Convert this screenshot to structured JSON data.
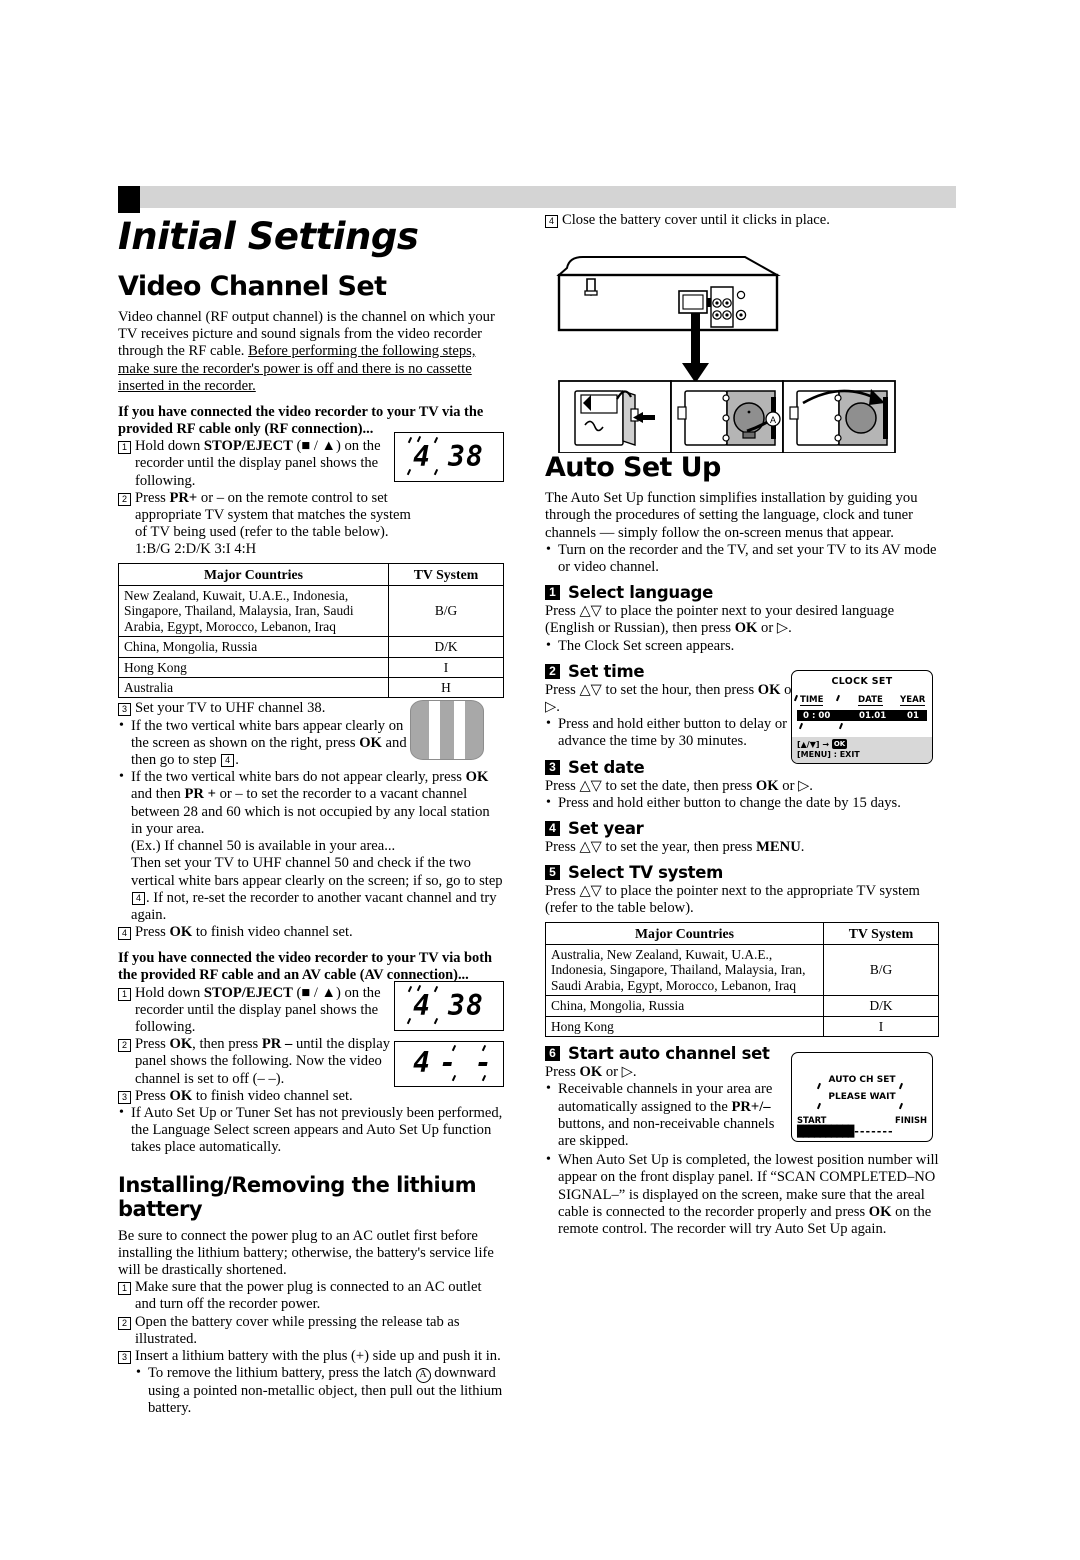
{
  "document": {
    "page_title": "Initial Settings"
  },
  "left_column": {
    "video_channel_set": {
      "heading": "Video Channel Set",
      "intro_plain": "Video channel (RF output channel) is the channel on which your TV receives picture and sound signals from the video recorder through the RF cable. ",
      "intro_underlined": "Before performing the following steps, make sure the recorder's power is off and there is no cassette inserted in the recorder.",
      "rf_section": {
        "lead": "If you have connected the video recorder to your TV via the provided RF cable only (RF connection)...",
        "step1_a": "Hold down ",
        "step1_b": "STOP/EJECT",
        "step1_c": " (■ / ▲) on the recorder until the display panel shows the following.",
        "step2_a": "Press ",
        "step2_b": "PR+",
        "step2_c": " or – on the remote control to set appropriate TV system that matches the system of TV being used (refer to the table below).",
        "systems_line": "1:B/G  2:D/K  3:I  4:H",
        "display_panel": {
          "channel_digit": "4",
          "channel_number": "38"
        },
        "step3": "Set your TV to UHF channel 38.",
        "bullet1_a": "If the two vertical white bars appear clearly on the screen as shown on the right, press ",
        "bullet1_b": "OK",
        "bullet1_c": " and then go to step ",
        "bullet1_step": "4",
        "bullet1_d": ".",
        "bullet2_a": "If the two vertical white bars do not appear clearly, press ",
        "bullet2_ok": "OK",
        "bullet2_b": " and then ",
        "bullet2_pr": "PR +",
        "bullet2_c": " or – to set the recorder to a vacant channel between 28 and 60 which is not occupied by any local station in your area.",
        "bullet2_ex": "(Ex.) If channel 50 is available in your area...",
        "bullet2_d": "Then set your TV to UHF channel 50 and check if the two vertical white bars appear clearly on the screen; if so, go to step ",
        "bullet2_step": "4",
        "bullet2_e": ". If not, re-set the recorder to another vacant channel and try again.",
        "step4_a": "Press ",
        "step4_b": "OK",
        "step4_c": " to finish video channel set."
      },
      "av_section": {
        "lead": "If you have connected the video recorder to your TV via both the provided RF cable and an AV cable (AV connection)...",
        "step1_a": "Hold down ",
        "step1_b": "STOP/EJECT",
        "step1_c": " (■ / ▲) on the recorder until the display panel shows the following.",
        "step2_a": "Press ",
        "step2_ok": "OK",
        "step2_b": ", then press ",
        "step2_pr": "PR –",
        "step2_c": " until the display panel shows the following. Now the video channel is set to off (– –).",
        "step3_a": "Press ",
        "step3_ok": "OK",
        "step3_b": " to finish video channel set.",
        "bullet1": "If Auto Set Up or Tuner Set has not previously been performed, the Language Select screen appears and Auto Set Up function takes place automatically.",
        "display_panel_1": {
          "channel_digit": "4",
          "channel_number": "38"
        },
        "display_panel_2": {
          "channel_digit": "4",
          "channel_number": "- -"
        }
      },
      "tv_system_table": {
        "headers": [
          "Major Countries",
          "TV System"
        ],
        "rows": [
          {
            "countries": "New Zealand, Kuwait, U.A.E., Indonesia, Singapore, Thailand, Malaysia, Iran, Saudi Arabia, Egypt, Morocco, Lebanon, Iraq",
            "system": "B/G"
          },
          {
            "countries": "China, Mongolia, Russia",
            "system": "D/K"
          },
          {
            "countries": "Hong Kong",
            "system": "I"
          },
          {
            "countries": "Australia",
            "system": "H"
          }
        ]
      }
    },
    "lithium_battery": {
      "heading": "Installing/Removing the lithium battery",
      "intro": "Be sure to connect the power plug to an AC outlet first before installing the lithium battery; otherwise, the battery's service life will be drastically shortened.",
      "step1": "Make sure that the power plug is connected to an AC outlet and turn off the recorder power.",
      "step2": "Open the battery cover while pressing the release tab as illustrated.",
      "step3": "Insert a lithium battery with the plus (+) side up and push it in.",
      "bullet1_a": "To remove the lithium battery, press the latch ",
      "bullet1_mark": "A",
      "bullet1_b": " downward using a pointed non-metallic object, then pull out the lithium battery."
    }
  },
  "right_column": {
    "battery_step4": "Close the battery cover until it clicks in place.",
    "battery_illustration": {
      "latch_label": "A"
    },
    "auto_set_up": {
      "heading": "Auto Set Up",
      "intro": "The Auto Set Up function simplifies installation by guiding you through the procedures of setting the language, clock and tuner channels — simply follow the on-screen menus that appear.",
      "intro_bullet": "Turn on the recorder and the TV, and set your TV to its AV mode or video channel.",
      "steps": [
        {
          "num": "1",
          "title": "Select language",
          "body_a": "Press △▽ to place the pointer next to your desired language (English or Russian), then press ",
          "body_b": "OK",
          "body_c": " or ▷.",
          "bullet": "The Clock Set screen appears."
        },
        {
          "num": "2",
          "title": "Set time",
          "body_a": "Press △▽ to set the hour, then press ",
          "body_b": "OK",
          "body_c": " or ▷.",
          "bullet": "Press and hold either button to delay or advance the time by 30 minutes."
        },
        {
          "num": "3",
          "title": "Set date",
          "body_a": "Press △▽ to set the date, then press ",
          "body_b": "OK",
          "body_c": " or ▷.",
          "bullet": "Press and hold either button to change the date by 15 days."
        },
        {
          "num": "4",
          "title": "Set year",
          "body_a": "Press △▽ to set the year, then press ",
          "body_b": "MENU",
          "body_c": ".",
          "bullet": ""
        },
        {
          "num": "5",
          "title": "Select TV system",
          "body_a": "Press △▽ to place the pointer next to the appropriate TV system (refer to the table below).",
          "body_b": "",
          "body_c": "",
          "bullet": ""
        },
        {
          "num": "6",
          "title": "Start auto channel set",
          "body_a": "Press ",
          "body_b": "OK",
          "body_c": " or ▷.",
          "bullet": ""
        }
      ],
      "step6_bullets": {
        "b1_a": "Receivable channels in your area are automatically assigned to the ",
        "b1_pr": "PR+/–",
        "b1_b": " buttons, and non-receivable channels are skipped.",
        "b2_a": "When Auto Set Up is completed, the lowest position number will appear on the front display panel. If “SCAN COMPLETED–NO SIGNAL–” is displayed on the screen, make sure that the areal cable is connected to the recorder properly and press ",
        "b2_ok": "OK",
        "b2_b": " on the remote control. The recorder will try Auto Set Up again."
      },
      "tv_system_table": {
        "headers": [
          "Major Countries",
          "TV System"
        ],
        "rows": [
          {
            "countries": "Australia, New Zealand, Kuwait, U.A.E., Indonesia, Singapore, Thailand, Malaysia, Iran, Saudi Arabia, Egypt, Morocco, Lebanon, Iraq",
            "system": "B/G"
          },
          {
            "countries": "China, Mongolia, Russia",
            "system": "D/K"
          },
          {
            "countries": "Hong Kong",
            "system": "I"
          }
        ]
      },
      "clock_set_osd": {
        "title": "CLOCK SET",
        "label_time": "TIME",
        "label_date": "DATE",
        "label_year": "YEAR",
        "value_time": "0 : 00",
        "value_date": "01.01",
        "value_year": "01",
        "footer_line1_keys": "[▲/▼]",
        "footer_line1_arrow": "→",
        "footer_line1_ok": "OK",
        "footer_line2": "[MENU] : EXIT"
      },
      "auto_ch_set_osd": {
        "title": "AUTO CH SET",
        "subtitle": "PLEASE WAIT",
        "start_label": "START",
        "finish_label": "FINISH",
        "progress_filled": "██████████",
        "progress_empty": "-------"
      }
    }
  },
  "colors": {
    "header_band": "#d4d4d4",
    "tv_screen_gray": "#a8a8a8",
    "osd_footer_gray": "#d8d8d8"
  }
}
